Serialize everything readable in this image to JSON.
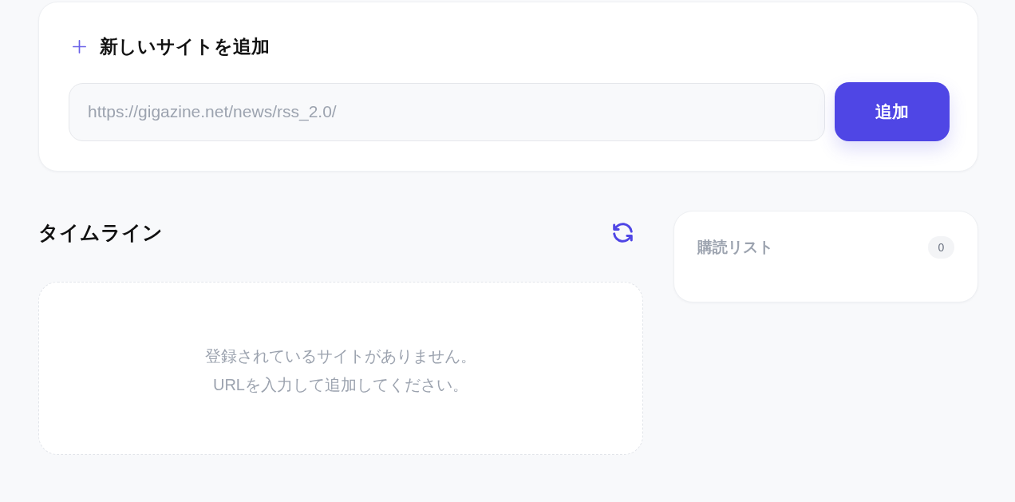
{
  "add_site": {
    "title": "新しいサイトを追加",
    "url_field": {
      "placeholder": "https://gigazine.net/news/rss_2.0/"
    },
    "add_button": "追加"
  },
  "timeline": {
    "title": "タイムライン",
    "empty_message": "登録されているサイトがありません。\nURLを入力して追加してください。"
  },
  "subscriptions": {
    "title": "購読リスト",
    "count": "0"
  }
}
